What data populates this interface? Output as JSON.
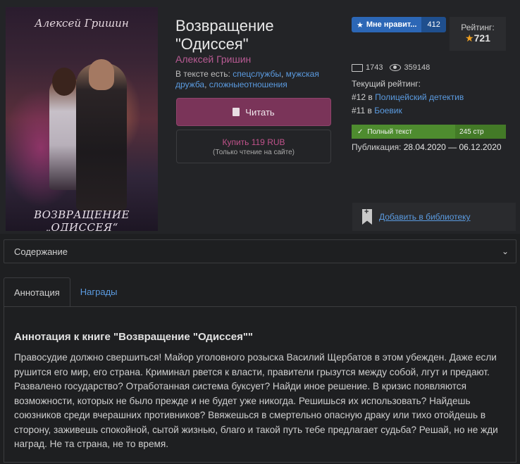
{
  "book": {
    "cover": {
      "author_script": "Алексей Гришин",
      "title_script": "ВОЗВРАЩЕНИЕ „ОДИССЕЯ“"
    },
    "title": "Возвращение \"Одиссея\"",
    "author": "Алексей Гришин",
    "tags_prefix": "В тексте есть:",
    "tags": [
      "спецслужбы",
      "мужская дружба",
      "сложныеотношения"
    ]
  },
  "actions": {
    "read_label": "Читать",
    "buy_label": "Купить 119 RUB",
    "buy_note": "(Только чтение на сайте)",
    "like_label": "Мне нравит...",
    "like_count": "412",
    "add_library": "Добавить в библиотеку"
  },
  "rating": {
    "label": "Рейтинг:",
    "value": "721"
  },
  "stats": {
    "chars": "1743",
    "views": "359148"
  },
  "current_rating": {
    "label": "Текущий рейтинг:",
    "items": [
      {
        "place": "#12",
        "in": "в",
        "genre": "Полицейский детектив"
      },
      {
        "place": "#11",
        "in": "в",
        "genre": "Боевик"
      }
    ]
  },
  "status": {
    "full_text": "Полный текст",
    "pages": "245 стр",
    "color": "#4e8c2f"
  },
  "publication": {
    "label": "Публикация:",
    "dates": "28.04.2020 — 06.12.2020"
  },
  "contents_select": {
    "label": "Содержание"
  },
  "tabs": [
    {
      "label": "Аннотация"
    },
    {
      "label": "Награды"
    }
  ],
  "annotation": {
    "title": "Аннотация к книге \"Возвращение \"Одиссея\"\"",
    "text": "Правосудие должно свершиться! Майор уголовного розыска Василий Щербатов в этом убежден. Даже если рушится его мир, его страна. Криминал рвется к власти, правители грызутся между собой, лгут и предают. Развалено государство? Отработанная система буксует? Найди иное решение. В кризис появляются возможности, которых не было прежде и не будет уже никогда. Решишься их использовать? Найдешь союзников среди вчерашних противников? Ввяжешься в смертельно опасную драку или тихо отойдешь в сторону, заживешь спокойной, сытой жизнью, благо и такой путь тебе предлагает судьба? Решай, но не жди наград. Не та страна, не то время."
  },
  "colors": {
    "accent_link": "#5b9be0",
    "author_pink": "#b95b94",
    "read_button": "#7a3459"
  }
}
